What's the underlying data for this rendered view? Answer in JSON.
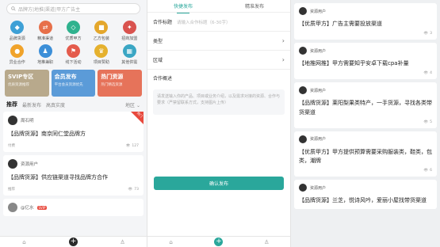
{
  "panel_left": {
    "search_placeholder": "品牌方|地推|渠道|甲方广告主",
    "grid": [
      {
        "label": "品牌货源",
        "icon": "bag-icon",
        "color": "#3ea0d6"
      },
      {
        "label": "精准渠道",
        "icon": "channel-icon",
        "color": "#e7704a"
      },
      {
        "label": "优质甲方",
        "icon": "diamond-icon",
        "color": "#2fb28e"
      },
      {
        "label": "乙方包装",
        "icon": "box-icon",
        "color": "#e4a72c"
      },
      {
        "label": "招商加盟",
        "icon": "handshake-icon",
        "color": "#d9534f"
      },
      {
        "label": "异业合作",
        "icon": "cooperate-icon",
        "color": "#f0a32b"
      },
      {
        "label": "地推兼职",
        "icon": "person-icon",
        "color": "#3c8fd8"
      },
      {
        "label": "线下活动",
        "icon": "flag-icon",
        "color": "#e45b4c"
      },
      {
        "label": "项目赞助",
        "icon": "crown-icon",
        "color": "#e5b12e"
      },
      {
        "label": "其他供需",
        "icon": "grid-icon",
        "color": "#3aa6c4"
      }
    ],
    "banners": [
      {
        "title": "SVIP专区",
        "sub": "优质资源推荐",
        "color": "#b8a98c"
      },
      {
        "title": "会员发布",
        "sub": "平台会员资源优先",
        "color": "#5b9bd8"
      },
      {
        "title": "热门资源",
        "sub": "热门精选资源",
        "color": "#e6735a"
      }
    ],
    "feed_tabs": [
      "推荐",
      "最新发布",
      "高真实度"
    ],
    "region": "地区",
    "cards": [
      {
        "name": "周石明",
        "title": "【品牌货源】南京同仁堂品牌方",
        "source": "付费",
        "views": "127",
        "hot": "热门"
      },
      {
        "name": "资源用户",
        "title": "【品牌货源】供应链渠道寻找品牌方合作",
        "source": "推荐",
        "views": "73"
      },
      {
        "name": "@亿水",
        "vip": "SVIP"
      }
    ]
  },
  "panel_mid": {
    "tabs": [
      "快捷发布",
      "精准发布"
    ],
    "fields": [
      {
        "label": "合作标题",
        "placeholder": "请输入合作标题（6-30字）"
      },
      {
        "label": "类型",
        "placeholder": ""
      },
      {
        "label": "区域",
        "placeholder": ""
      }
    ],
    "desc_label": "合作概述",
    "desc_placeholder": "请发送输入你的产品、项目或业务介绍，以及需求对接的资源、合作与要求（严禁留联系方式，支持图片上传）",
    "submit": "确认发布"
  },
  "panel_right": {
    "cards": [
      {
        "name": "资源用户",
        "title": "【优质甲方】广告主需要投放渠道",
        "views": "3"
      },
      {
        "name": "资源用户",
        "title": "【地推网推】甲方需要知乎安卓下载cpa补量",
        "views": "4"
      },
      {
        "name": "资源用户",
        "title": "【品牌货源】莱阳梨果类特产，一手货源，寻找各类带货渠道",
        "views": "5"
      },
      {
        "name": "资源用户",
        "title": "【优质甲方】甲方提供预算需要采购服装类，鞋类，包类，潮牌",
        "views": "6"
      },
      {
        "name": "资源用户",
        "title": "【品牌货源】兰芝，悦诗风吟，爱丽小屋找带货渠道",
        "views": "8"
      }
    ]
  }
}
